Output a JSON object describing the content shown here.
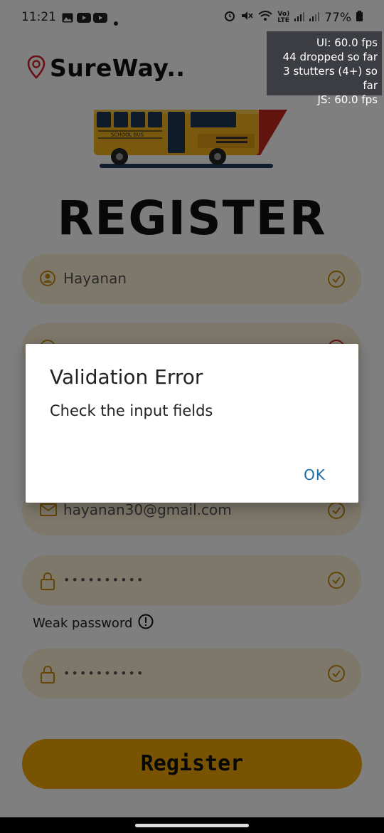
{
  "status_bar": {
    "time": "11:21",
    "battery": "77%",
    "left_icons": [
      "gallery-icon",
      "youtube-icon",
      "youtube-icon",
      "dot-icon"
    ],
    "right_icons": [
      "alarm-icon",
      "mute-icon",
      "wifi-icon",
      "volte-icon",
      "signal-icon",
      "signal-icon",
      "battery-icon"
    ]
  },
  "perf_overlay": {
    "ui_fps": "UI: 60.0 fps",
    "dropped": "44 dropped so far",
    "stutters": "3 stutters (4+) so far",
    "js_fps": "JS: 60.0 fps"
  },
  "brand": {
    "name": "SureWay..",
    "icon": "location-pin-icon",
    "color": "#d3222a"
  },
  "hero": {
    "bus_label": "SCHOOL BUS"
  },
  "page_title": "REGISTER",
  "form": {
    "username": {
      "value": "Hayanan",
      "icon": "user-icon",
      "status": "valid"
    },
    "email": {
      "value": "hayanan30@gmail.com",
      "icon": "mail-icon",
      "status": "valid"
    },
    "password": {
      "value": "••••••••••",
      "icon": "lock-icon",
      "status": "valid"
    },
    "password_hint": "Weak password",
    "confirm_password": {
      "value": "••••••••••",
      "icon": "lock-icon",
      "status": "valid"
    },
    "submit_label": "Register"
  },
  "dialog": {
    "title": "Validation Error",
    "message": "Check the input fields",
    "ok_label": "OK"
  },
  "colors": {
    "accent": "#f0a708",
    "field_bg": "#fdf1d7",
    "dialog_button": "#1b6ea8"
  }
}
